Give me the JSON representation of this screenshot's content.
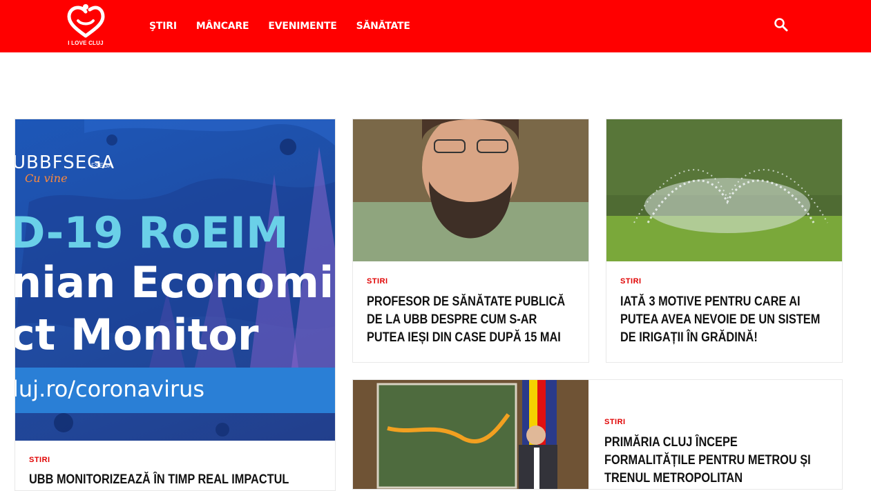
{
  "header": {
    "logo_text": "I LOVE CLUJ",
    "nav": [
      "ŞTIRI",
      "MÂNCARE",
      "EVENIMENTE",
      "SĂNĂTATE"
    ],
    "brand_color": "#ff0000",
    "search_icon": "search-icon"
  },
  "featured": {
    "image_text": {
      "brand": "UBBFSEGA",
      "brand_sub": "Cu vine",
      "brand_small": "FSEGA",
      "line1": "D-19 RoEIM",
      "line2": "nian Economic",
      "line3": "ct Monitor",
      "url": "luj.ro/coronavirus"
    },
    "category": "STIRI",
    "title": "UBB MONITORIZEAZĂ ÎN TIMP REAL IMPACTUL"
  },
  "articles": [
    {
      "category": "STIRI",
      "title": "PROFESOR DE SĂNĂTATE PUBLICĂ DE LA UBB DESPRE CUM S-AR PUTEA IEȘI DIN CASE DUPĂ 15 MAI"
    },
    {
      "category": "STIRI",
      "title": "IATĂ 3 MOTIVE PENTRU CARE AI PUTEA AVEA NEVOIE DE UN SISTEM DE IRIGAȚII ÎN GRĂDINĂ!"
    },
    {
      "category": "STIRI",
      "title": "PRIMĂRIA CLUJ ÎNCEPE FORMALITĂȚILE PENTRU METROU ȘI TRENUL METROPOLITAN"
    }
  ]
}
